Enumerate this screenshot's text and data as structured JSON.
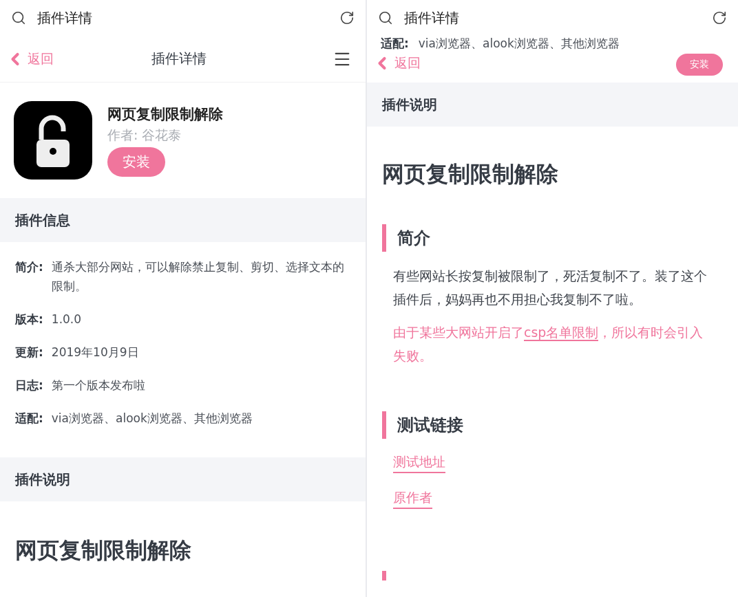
{
  "left_screen": {
    "search": {
      "value": "插件详情"
    },
    "nav": {
      "back": "返回",
      "title": "插件详情"
    },
    "plugin": {
      "name": "网页复制限制解除",
      "author": "作者: 谷花泰",
      "install": "安装"
    },
    "info_section": {
      "title": "插件信息",
      "rows": [
        {
          "label": "简介:",
          "value": "通杀大部分网站，可以解除禁止复制、剪切、选择文本的限制。"
        },
        {
          "label": "版本:",
          "value": "1.0.0"
        },
        {
          "label": "更新:",
          "value": "2019年10月9日"
        },
        {
          "label": "日志:",
          "value": "第一个版本发布啦"
        },
        {
          "label": "适配:",
          "value": "via浏览器、alook浏览器、其他浏览器"
        }
      ]
    },
    "description_section": {
      "title": "插件说明",
      "heading": "网页复制限制解除"
    }
  },
  "right_screen": {
    "search": {
      "value": "插件详情"
    },
    "scrolled_row": {
      "label": "适配:",
      "value": "via浏览器、alook浏览器、其他浏览器"
    },
    "nav": {
      "back": "返回",
      "install": "安装"
    },
    "description_section": {
      "title": "插件说明",
      "heading": "网页复制限制解除",
      "blocks": [
        {
          "kind": "subheading",
          "text": "简介"
        },
        {
          "kind": "paragraph",
          "text": "有些网站长按复制被限制了，死活复制不了。装了这个插件后，妈妈再也不用担心我复制不了啦。"
        },
        {
          "kind": "notice",
          "before": "由于某些大网站开启了",
          "link": "csp名单限制",
          "after": "，所以有时会引入失败。"
        },
        {
          "kind": "subheading",
          "text": "测试链接"
        },
        {
          "kind": "link",
          "text": "测试地址"
        },
        {
          "kind": "link",
          "text": "原作者"
        },
        {
          "kind": "marker"
        }
      ]
    }
  }
}
